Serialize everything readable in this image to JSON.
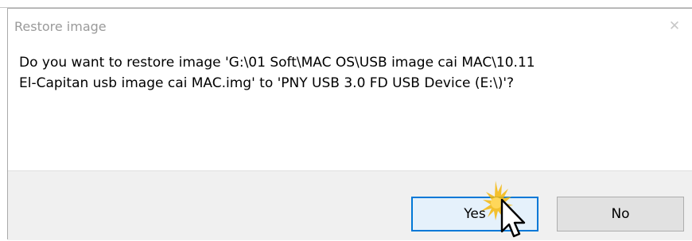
{
  "dialog": {
    "title": "Restore image",
    "close_glyph": "✕",
    "message_line1": "Do you want to restore image 'G:\\01 Soft\\MAC OS\\USB image cai MAC\\10.11",
    "message_line2": "El-Capitan usb image cai MAC.img' to 'PNY USB 3.0 FD USB Device (E:\\)'?",
    "buttons": {
      "yes_label": "Yes",
      "no_label": "No"
    }
  },
  "icons": {
    "close": "close-icon",
    "cursor": "arrow-cursor-icon"
  },
  "colors": {
    "focus_border": "#0078d7",
    "footer_bg": "#f0f0f0",
    "click_burst": "#f5b70a"
  }
}
